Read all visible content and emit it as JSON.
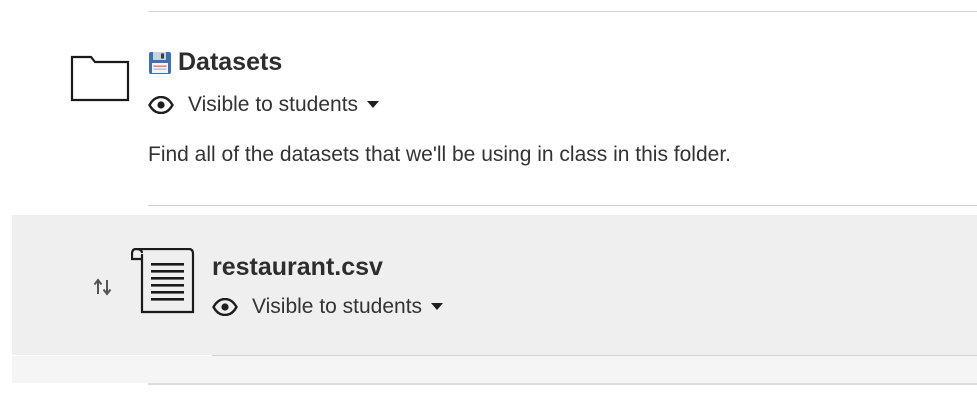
{
  "folder": {
    "icon": "folder-icon",
    "emoji_icon": "floppy-disk-icon",
    "title": "Datasets",
    "visibility": "Visible to students",
    "description": "Find all of the datasets that we'll be using in class in this folder."
  },
  "file": {
    "icon": "document-icon",
    "title": "restaurant.csv",
    "visibility": "Visible to students",
    "row_background": "#efefef"
  }
}
